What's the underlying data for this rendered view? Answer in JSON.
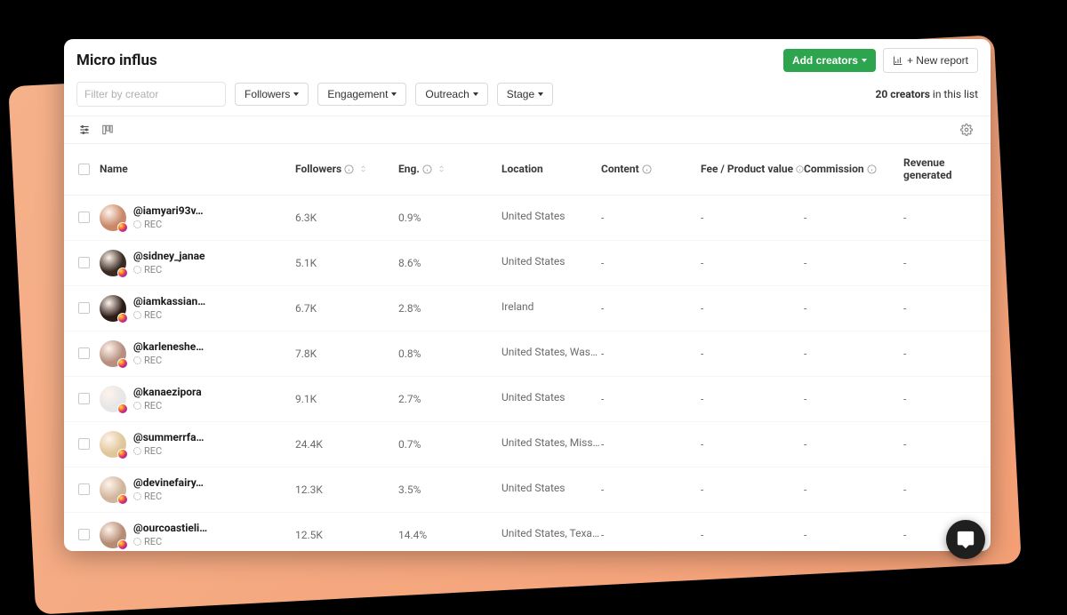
{
  "title": "Micro influs",
  "actions": {
    "add_creators": "Add creators",
    "new_report": "+ New report"
  },
  "filters": {
    "search_placeholder": "Filter by creator",
    "followers": "Followers",
    "engagement": "Engagement",
    "outreach": "Outreach",
    "stage": "Stage"
  },
  "summary": {
    "count": "20 creators",
    "suffix": " in this list"
  },
  "columns": {
    "name": "Name",
    "followers": "Followers",
    "eng": "Eng.",
    "location": "Location",
    "content": "Content",
    "fee": "Fee / Product value",
    "commission": "Commission",
    "revenue": "Revenue generated"
  },
  "rec_label": "REC",
  "avatars": {
    "colors": [
      "#c9886a",
      "#3a2a23",
      "#2b1c17",
      "#b68f81",
      "#e6e6e6",
      "#e0c79b",
      "#d1b59c",
      "#b58c74"
    ]
  },
  "rows": [
    {
      "handle": "@iamyari93v…",
      "followers": "6.3K",
      "eng": "0.9%",
      "location": "United States",
      "content": "-",
      "fee": "-",
      "commission": "-",
      "revenue": "-"
    },
    {
      "handle": "@sidney_janae",
      "followers": "5.1K",
      "eng": "8.6%",
      "location": "United States",
      "content": "-",
      "fee": "-",
      "commission": "-",
      "revenue": "-"
    },
    {
      "handle": "@iamkassian…",
      "followers": "6.7K",
      "eng": "2.8%",
      "location": "Ireland",
      "content": "-",
      "fee": "-",
      "commission": "-",
      "revenue": "-"
    },
    {
      "handle": "@karleneshe…",
      "followers": "7.8K",
      "eng": "0.8%",
      "location": "United States, Washi…",
      "content": "-",
      "fee": "-",
      "commission": "-",
      "revenue": "-"
    },
    {
      "handle": "@kanaezipora",
      "followers": "9.1K",
      "eng": "2.7%",
      "location": "United States",
      "content": "-",
      "fee": "-",
      "commission": "-",
      "revenue": "-"
    },
    {
      "handle": "@summerrfa…",
      "followers": "24.4K",
      "eng": "0.7%",
      "location": "United States, Missi…",
      "content": "-",
      "fee": "-",
      "commission": "-",
      "revenue": "-"
    },
    {
      "handle": "@devinefairy…",
      "followers": "12.3K",
      "eng": "3.5%",
      "location": "United States",
      "content": "-",
      "fee": "-",
      "commission": "-",
      "revenue": "-"
    },
    {
      "handle": "@ourcoastieli…",
      "followers": "12.5K",
      "eng": "14.4%",
      "location": "United States, Texas,…",
      "content": "-",
      "fee": "-",
      "commission": "-",
      "revenue": "-"
    }
  ]
}
